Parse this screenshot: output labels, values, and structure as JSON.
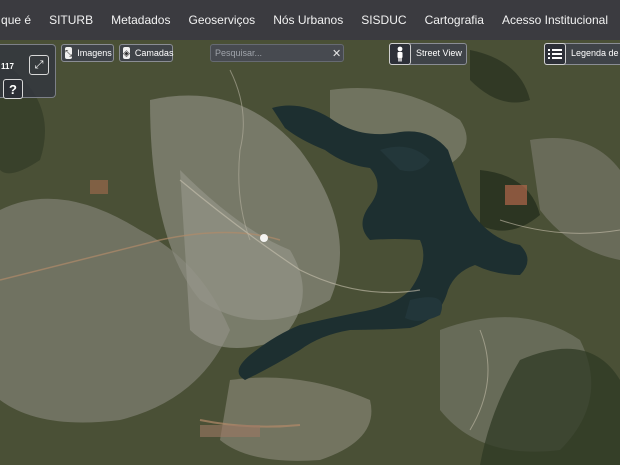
{
  "nav": {
    "items": [
      "O que é",
      "SITURB",
      "Metadados",
      "Geoserviços",
      "Nós Urbanos",
      "SISDUC",
      "Cartografia",
      "Acesso Institucional"
    ]
  },
  "scale_panel": {
    "scale_text": "117",
    "icon": "expand-icon"
  },
  "help": {
    "label": "?"
  },
  "toolbar": {
    "imagens_label": "Imagens",
    "camadas_label": "Camadas"
  },
  "search": {
    "placeholder": "Pesquisar...",
    "value": "",
    "clear_label": "✕"
  },
  "street_view": {
    "label": "Street View",
    "icon": "pegman-icon"
  },
  "legend": {
    "label": "Legenda de ...",
    "icon": "list-icon"
  },
  "colors": {
    "lake": "#1d2f30",
    "urban": "#8f9088",
    "vegetation": "#3b4530",
    "topbar": "#3b3b40"
  }
}
